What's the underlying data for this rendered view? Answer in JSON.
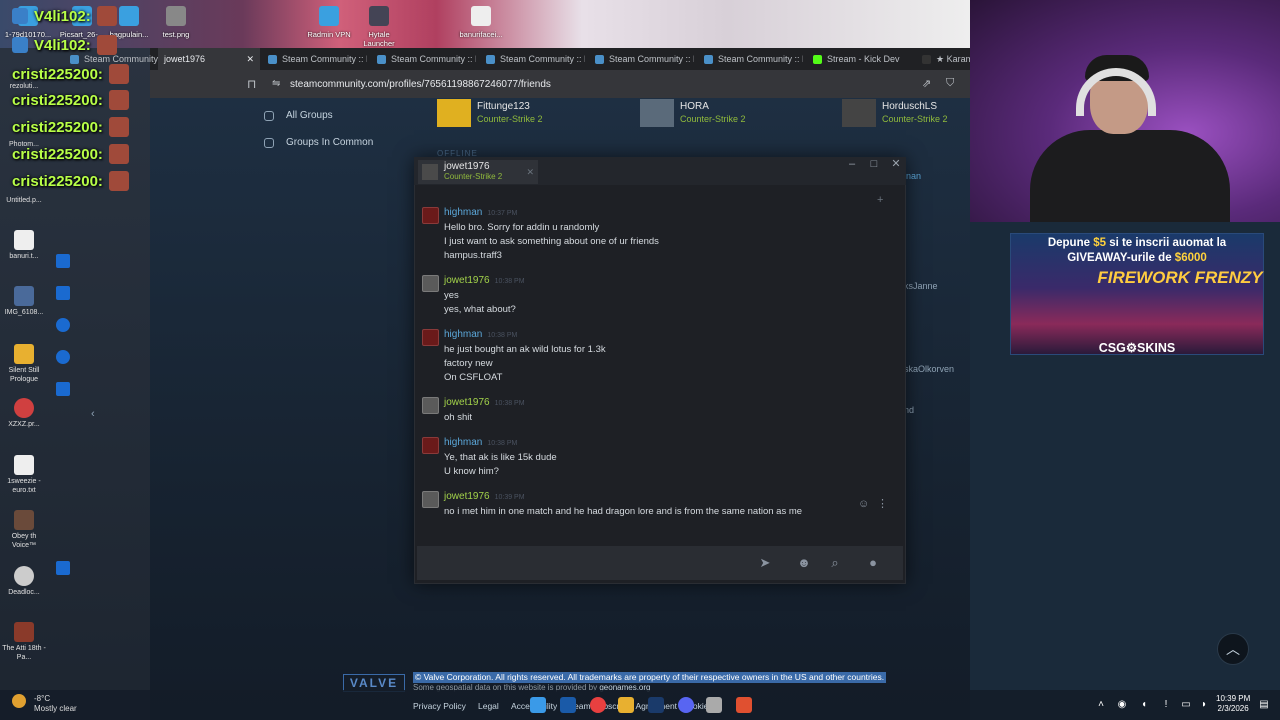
{
  "browser": {
    "tabs": [
      {
        "label": "Steam Community :: F"
      },
      {
        "label": "jowet1976"
      },
      {
        "label": "Steam Community :: E"
      },
      {
        "label": "Steam Community :: E"
      },
      {
        "label": "Steam Community :: E"
      },
      {
        "label": "Steam Community :: E"
      },
      {
        "label": "Steam Community :: E"
      },
      {
        "label": "Stream - Kick Dev"
      },
      {
        "label": "★ Karam"
      }
    ],
    "url": "steamcommunity.com/profiles/76561198867246077/friends"
  },
  "desktop_top_icons": [
    {
      "label": "1-79d10170..."
    },
    {
      "label": "Picsart_26-..."
    },
    {
      "label": "bagpulain..."
    },
    {
      "label": "test.png"
    },
    {
      "label": "Radmin VPN"
    },
    {
      "label": "Hytale Launcher"
    },
    {
      "label": "banurifacei..."
    }
  ],
  "desktop_side_icons": [
    {
      "label": "rezoluti..."
    },
    {
      "label": "Photom..."
    },
    {
      "label": "Untitled.p..."
    },
    {
      "label": "banuri.t..."
    },
    {
      "label": "IMG_6108..."
    },
    {
      "label": "Silent Still Prologue"
    },
    {
      "label": "XZXZ.pr..."
    },
    {
      "label": "1sweezie - euro.txt"
    },
    {
      "label": "Obey th Voice™"
    },
    {
      "label": "Deadloc..."
    },
    {
      "label": "The Atti 18th - Pa..."
    }
  ],
  "stream_chat": [
    {
      "name": "V4li102:"
    },
    {
      "name": "V4li102:"
    },
    {
      "name": "cristi225200:"
    },
    {
      "name": "cristi225200:"
    },
    {
      "name": "cristi225200:"
    },
    {
      "name": "cristi225200:"
    },
    {
      "name": "cristi225200:"
    }
  ],
  "steam_page": {
    "groups": [
      {
        "label": "All Groups"
      },
      {
        "label": "Groups In Common"
      }
    ],
    "friends_cards": [
      {
        "name": "Fittunge123",
        "game": "Counter-Strike 2"
      },
      {
        "name": "HORA",
        "game": "Counter-Strike 2"
      },
      {
        "name": "HorduschLS",
        "game": "Counter-Strike 2"
      }
    ],
    "offline_label": "OFFLINE",
    "partial_right": [
      "nan",
      "ksJanne",
      "skaOlkorven",
      "nd"
    ]
  },
  "chat": {
    "tab_name": "jowet1976",
    "tab_game": "Counter-Strike 2",
    "messages": [
      {
        "author": "highman",
        "time": "10:37 PM",
        "lines": [
          "Hello bro. Sorry for addin u randomly",
          "I just want to ask something about one of ur friends",
          "hampus.traff3"
        ]
      },
      {
        "author": "jowet1976",
        "time": "10:38 PM",
        "lines": [
          "yes",
          "yes, what about?"
        ]
      },
      {
        "author": "highman",
        "time": "10:38 PM",
        "lines": [
          "he just bought an ak wild lotus for 1.3k",
          "factory new",
          "On CSFLOAT"
        ]
      },
      {
        "author": "jowet1976",
        "time": "10:38 PM",
        "lines": [
          "oh shit"
        ]
      },
      {
        "author": "highman",
        "time": "10:38 PM",
        "lines": [
          "Ye, that ak is like 15k dude",
          "U know him?"
        ]
      },
      {
        "author": "jowet1976",
        "time": "10:39 PM",
        "lines": [
          "no i met him in one match and he had dragon lore and is from the same nation as me"
        ]
      }
    ]
  },
  "ad": {
    "line1_a": "Depune ",
    "line1_amount": "$5",
    "line1_b": " si te inscrii auomat la",
    "line2_a": "GIVEAWAY-urile de ",
    "line2_amount": "$6000",
    "game_title": "FIREWORK FRENZY",
    "brand": "CSG⚙SKINS"
  },
  "footer": {
    "valve": "VALVE",
    "copyright": "© Valve Corporation. All rights reserved. All trademarks are property of their respective owners in the US and other countries.",
    "geo_prefix": "Some geospatial data on this website is provided by ",
    "geo_link": "geonames.org",
    "links": [
      {
        "label": "Privacy Policy"
      },
      {
        "label": "Legal"
      },
      {
        "label": "Accessibility"
      },
      {
        "label": "Steam Subscriber Agreement"
      },
      {
        "label": "Cookies"
      }
    ]
  },
  "taskbar": {
    "temp": "-8°C",
    "weather": "Mostly clear",
    "time": "10:39 PM",
    "date": "2/3/2026"
  }
}
